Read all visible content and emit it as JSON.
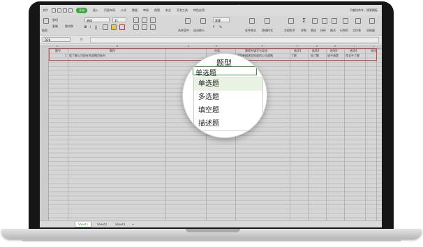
{
  "menubar": {
    "file": "文件",
    "items": [
      "开始",
      "插入",
      "页面布局",
      "公式",
      "数据",
      "审阅",
      "视图",
      "安全",
      "开发工具",
      "特色应用"
    ],
    "active_index": 0,
    "search": "Q查找命令、搜索模板"
  },
  "ribbon": {
    "labels": [
      "粘贴",
      "剪切",
      "复制",
      "格式刷",
      "合并居中",
      "自动换行",
      "条件格式",
      "表格样式",
      "文档助手",
      "求和",
      "筛选",
      "排序",
      "格式",
      "行和列",
      "工作表",
      "冻结窗"
    ],
    "font_name": "宋体",
    "font_size": "11",
    "number_format": "常规"
  },
  "formula_bar": {
    "name_box": "D26",
    "fx": "fx"
  },
  "grid": {
    "col_letters": [
      "A",
      "B",
      "C",
      "D",
      "E",
      "F",
      "G",
      "H",
      "I",
      "J"
    ],
    "header_row": {
      "a": "题号",
      "b": "题目",
      "c": "题型",
      "d": "分类",
      "e": "需就外填写与导语",
      "f": "选项1",
      "g": "选项2",
      "h": "选项3",
      "i": "选项4",
      "j": "选项"
    },
    "data_row": {
      "a": "1",
      "b": "您了解公司现在的战略目标吗",
      "d": "分组填写",
      "e": "请简单描述您知道的公司战略",
      "f": "了解",
      "g": "较了解",
      "h": "说不清楚",
      "i": "完全不了解"
    }
  },
  "magnifier": {
    "column_header": "题型",
    "cell_value": "单选题",
    "options": [
      "单选题",
      "多选题",
      "填空题",
      "描述题"
    ],
    "selected_index": 0
  },
  "sheet_tabs": {
    "tabs": [
      "Sheet1",
      "Sheet2",
      "Sheet3"
    ],
    "active_index": 0,
    "add": "+"
  }
}
